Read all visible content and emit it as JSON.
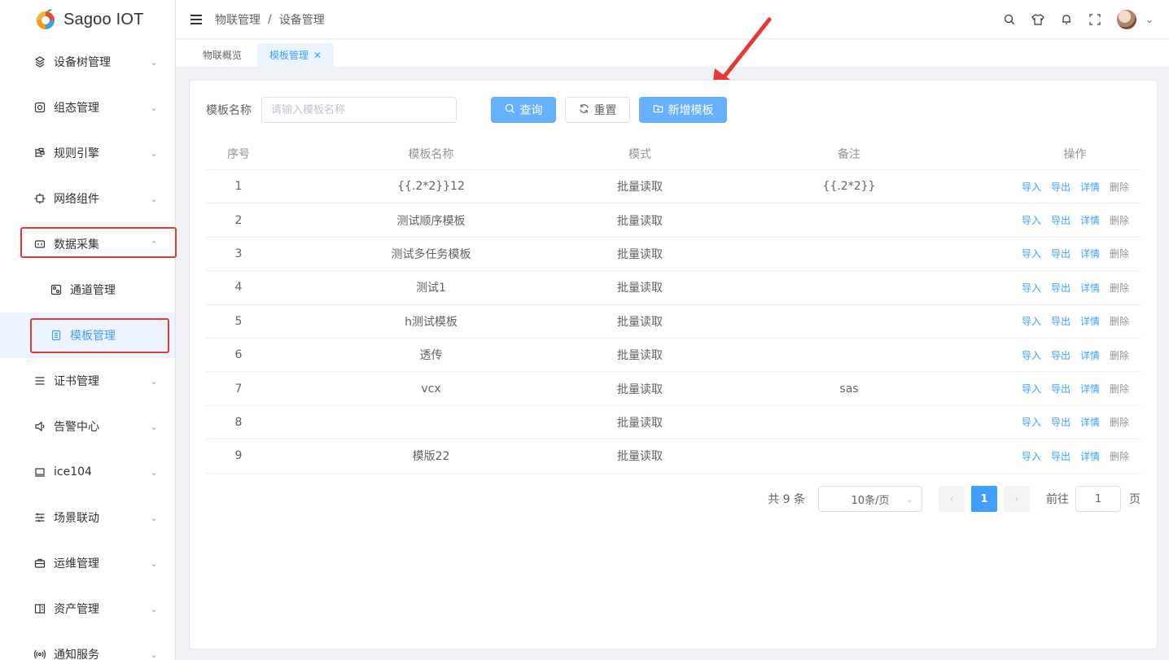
{
  "app": {
    "name": "Sagoo IOT"
  },
  "sidebar": {
    "items": [
      {
        "label": "设备树管理",
        "icon": "tree-icon",
        "arrow": "down"
      },
      {
        "label": "组态管理",
        "icon": "config-icon",
        "arrow": "down"
      },
      {
        "label": "规则引擎",
        "icon": "rule-icon",
        "arrow": "down"
      },
      {
        "label": "网络组件",
        "icon": "network-icon",
        "arrow": "down"
      },
      {
        "label": "数据采集",
        "icon": "collect-icon",
        "arrow": "up"
      },
      {
        "label": "通道管理",
        "icon": "channel-icon",
        "sub": true
      },
      {
        "label": "模板管理",
        "icon": "template-icon",
        "sub": true,
        "active": true
      },
      {
        "label": "证书管理",
        "icon": "cert-icon",
        "arrow": "down"
      },
      {
        "label": "告警中心",
        "icon": "alarm-icon",
        "arrow": "down"
      },
      {
        "label": "ice104",
        "icon": "monitor-icon",
        "arrow": "down"
      },
      {
        "label": "场景联动",
        "icon": "scene-icon",
        "arrow": "down"
      },
      {
        "label": "运维管理",
        "icon": "ops-icon",
        "arrow": "down"
      },
      {
        "label": "资产管理",
        "icon": "asset-icon",
        "arrow": "down"
      },
      {
        "label": "通知服务",
        "icon": "notify-icon",
        "arrow": "down"
      }
    ]
  },
  "header": {
    "breadcrumb": [
      "物联管理",
      "设备管理"
    ],
    "separator": "/"
  },
  "tabs": [
    {
      "label": "物联概览"
    },
    {
      "label": "模板管理",
      "active": true,
      "close": "✕"
    }
  ],
  "search": {
    "label": "模板名称",
    "placeholder": "请输入模板名称",
    "query_label": "查询",
    "reset_label": "重置",
    "add_label": "新增模板"
  },
  "table": {
    "headers": [
      "序号",
      "模板名称",
      "模式",
      "备注",
      "操作"
    ],
    "rows": [
      {
        "no": "1",
        "name": "{{.2*2}}12",
        "mode": "批量读取",
        "remark": "{{.2*2}}"
      },
      {
        "no": "2",
        "name": "测试顺序模板",
        "mode": "批量读取",
        "remark": ""
      },
      {
        "no": "3",
        "name": "测试多任务模板",
        "mode": "批量读取",
        "remark": ""
      },
      {
        "no": "4",
        "name": "测试1",
        "mode": "批量读取",
        "remark": ""
      },
      {
        "no": "5",
        "name": "h测试模板",
        "mode": "批量读取",
        "remark": ""
      },
      {
        "no": "6",
        "name": "透传",
        "mode": "批量读取",
        "remark": ""
      },
      {
        "no": "7",
        "name": "vcx",
        "mode": "批量读取",
        "remark": "sas"
      },
      {
        "no": "8",
        "name": "",
        "mode": "批量读取",
        "remark": ""
      },
      {
        "no": "9",
        "name": "模版22",
        "mode": "批量读取",
        "remark": ""
      }
    ],
    "ops": {
      "import": "导入",
      "export": "导出",
      "detail": "详情",
      "delete": "删除"
    }
  },
  "pagination": {
    "total": "共 9 条",
    "page_size": "10条/页",
    "current": "1",
    "goto_label": "前往",
    "goto_value": "1",
    "page_suffix": "页"
  },
  "colors": {
    "primary": "#409eff",
    "annotation": "#e53935"
  }
}
